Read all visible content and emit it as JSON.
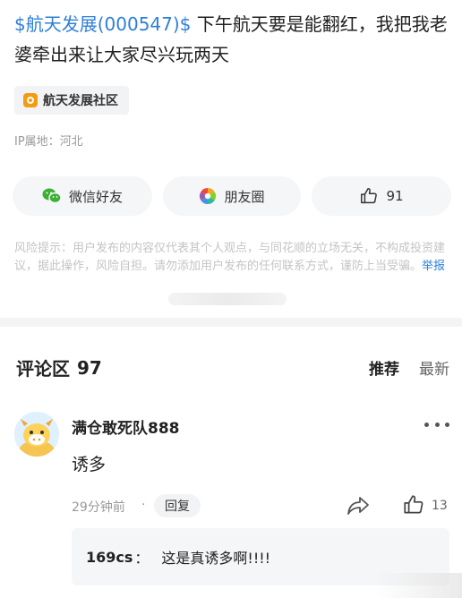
{
  "post": {
    "stock_link": "$航天发展(000547)$",
    "text": " 下午航天要是能翻红，我把我老婆牵出来让大家尽兴玩两天"
  },
  "tag": {
    "label": "航天发展社区",
    "icon": "community-icon",
    "color": "#f39c12"
  },
  "ip": "IP属地：河北",
  "share": {
    "wechat": "微信好友",
    "moments": "朋友圈",
    "likes": "91"
  },
  "risk_notice": {
    "text": "风险提示：用户发布的内容仅代表其个人观点，与同花顺的立场无关，不构成投资建议，据此操作，风险自担。请勿添加用户发布的任何联系方式，谨防上当受骗。",
    "report_label": "举报"
  },
  "comments": {
    "title": "评论区",
    "count": "97",
    "sort_recommended": "推荐",
    "sort_latest": "最新",
    "items": [
      {
        "username": "满仓敢死队888",
        "text": "诱多",
        "time": "29分钟前",
        "dot": "·",
        "reply_label": "回复",
        "likes": "13",
        "sub_reply": {
          "user": "169cs",
          "colon": "：",
          "text": "这是真诱多啊!!!!"
        }
      }
    ]
  },
  "colors": {
    "link": "#2f7fd8",
    "accent": "#f39c12",
    "muted": "#999999"
  }
}
